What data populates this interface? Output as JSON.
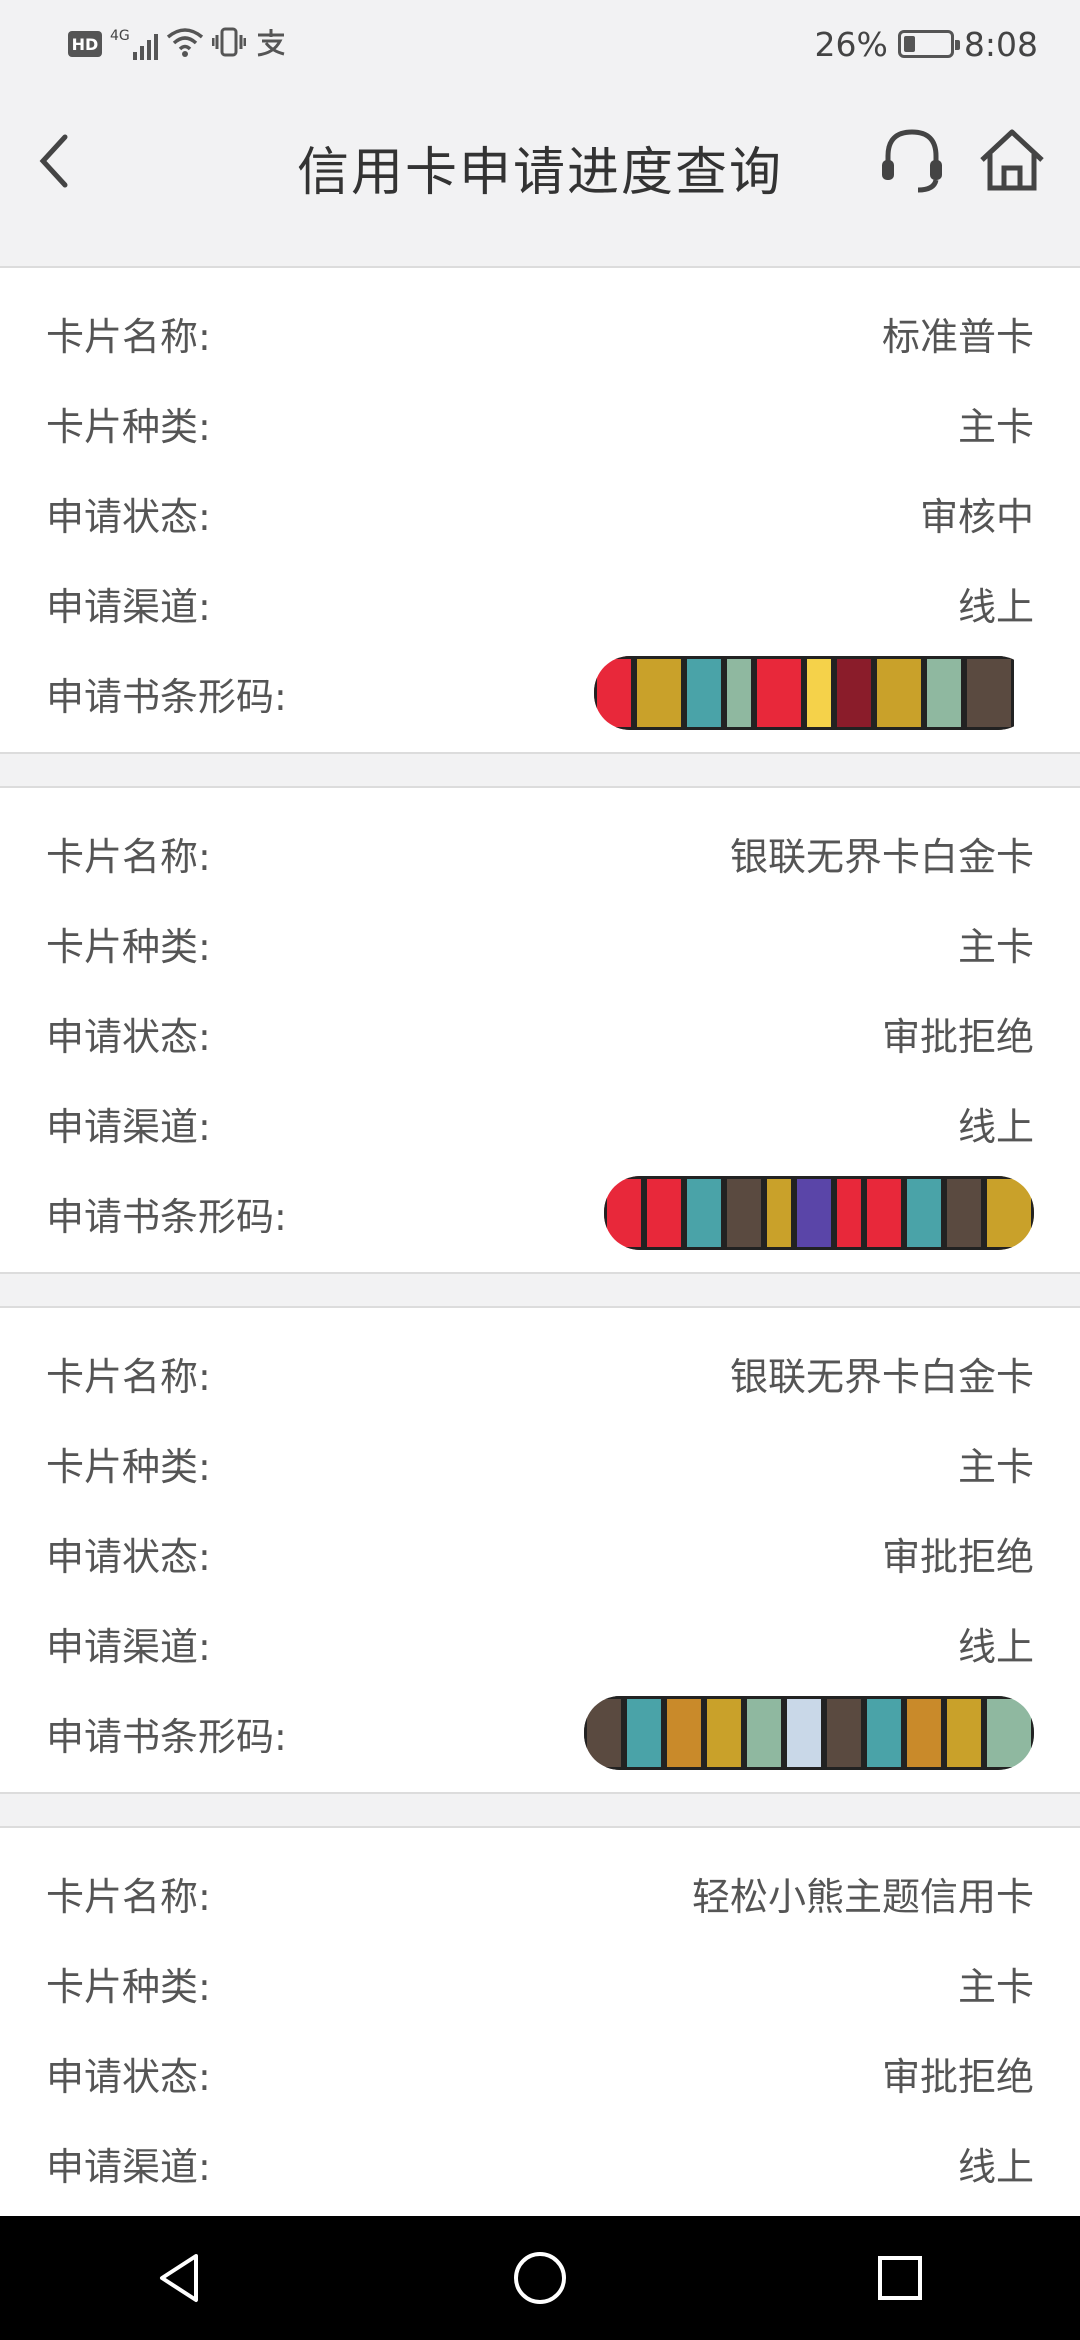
{
  "status_bar": {
    "left_icons": [
      "hd-icon",
      "4g-signal-icon",
      "wifi-icon",
      "vibrate-icon",
      "alipay-icon"
    ],
    "hd_text": "HD",
    "network_text": "4G",
    "battery_percent": "26%",
    "battery_level": 0.26,
    "time": "8:08"
  },
  "header": {
    "title": "信用卡申请进度查询",
    "back_icon": "chevron-left-icon",
    "support_icon": "headset-icon",
    "home_icon": "home-icon"
  },
  "labels": {
    "card_name": "卡片名称:",
    "card_type": "卡片种类:",
    "status": "申请状态:",
    "channel": "申请渠道:",
    "barcode": "申请书条形码:"
  },
  "applications": [
    {
      "card_name": "标准普卡",
      "card_type": "主卡",
      "status": "审核中",
      "channel": "线上"
    },
    {
      "card_name": "银联无界卡白金卡",
      "card_type": "主卡",
      "status": "审批拒绝",
      "channel": "线上"
    },
    {
      "card_name": "银联无界卡白金卡",
      "card_type": "主卡",
      "status": "审批拒绝",
      "channel": "线上"
    },
    {
      "card_name": "轻松小熊主题信用卡",
      "card_type": "主卡",
      "status": "审批拒绝",
      "channel": "线上"
    }
  ],
  "nav_bar": {
    "back_icon": "triangle-back-icon",
    "home_icon": "circle-home-icon",
    "recents_icon": "square-recents-icon"
  }
}
